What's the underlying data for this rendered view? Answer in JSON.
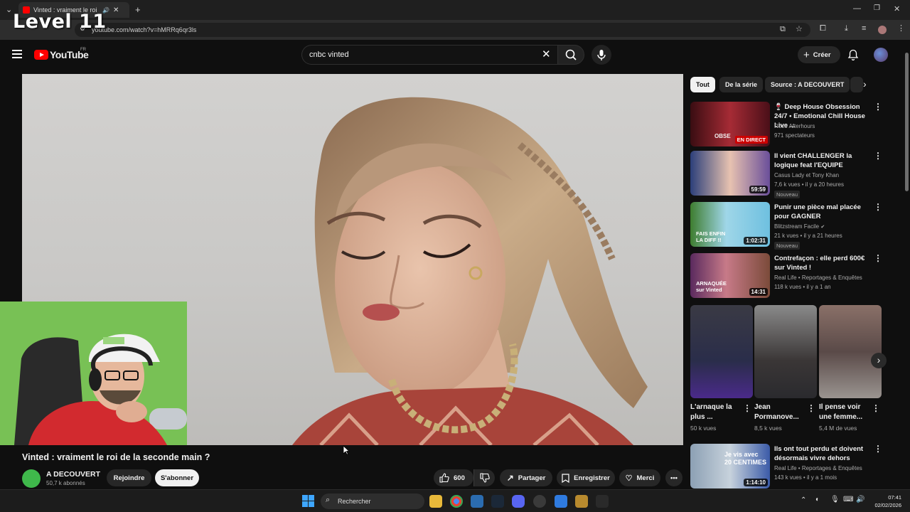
{
  "overlay": {
    "level_text": "Level 11"
  },
  "browser": {
    "tab_title": "Vinted : vraiment le roi de la seconde main ?",
    "url": "youtube.com/watch?v=hMRRq6qr3ls"
  },
  "youtube": {
    "logo_text": "YouTube",
    "region": "FR",
    "search_value": "cnbc vinted",
    "create_label": "Créer"
  },
  "video": {
    "title": "Vinted : vraiment le roi de la seconde main ?",
    "channel_name": "A DECOUVERT",
    "subscribers": "50,7 k abonnés",
    "join_label": "Rejoindre",
    "subscribe_label": "S'abonner",
    "likes": "600",
    "share_label": "Partager",
    "save_label": "Enregistrer",
    "thanks_label": "Merci"
  },
  "chips": [
    "Tout",
    "De la série",
    "Source : A DECOUVERT"
  ],
  "recommendations": [
    {
      "title": "🍷 Deep House Obsession 24/7 • Emotional Chill House Live ...",
      "channel": "Rose Afterhours",
      "meta": "971 spectateurs",
      "badge": "EN DIRECT",
      "thumb_text": "OBSE"
    },
    {
      "title": "Il vient CHALLENGER la logique feat l'EQUIPE",
      "channel": "Casus Lady et Tony Khan",
      "meta": "7,6 k vues • il y a 20 heures",
      "new": "Nouveau",
      "duration": "59:59"
    },
    {
      "title": "Punir une pièce mal placée pour GAGNER",
      "channel": "Blitzstream Facile",
      "meta": "21 k vues • il y a 21 heures",
      "new": "Nouveau",
      "duration": "1:02:31",
      "thumb_text": "FAIS ENFIN LA DIFF !!"
    },
    {
      "title": "Contrefaçon : elle perd 600€ sur Vinted !",
      "channel": "Real Life • Reportages & Enquêtes",
      "meta": "118 k vues • il y a 1 an",
      "duration": "14:31",
      "thumb_text": "ARNAQUÉE sur Vinted"
    },
    {
      "title": "Ils ont tout perdu et doivent désormais vivre dehors",
      "channel": "Real Life • Reportages & Enquêtes",
      "meta": "143 k vues • il y a 1 mois",
      "duration": "1:14:10",
      "thumb_text": "Je vis avec 20 CENTIMES"
    }
  ],
  "shorts": [
    {
      "title": "L'arnaque la plus ...",
      "views": "50 k vues"
    },
    {
      "title": "Jean Pormanove...",
      "views": "8,5 k vues"
    },
    {
      "title": "Il pense voir une femme...",
      "views": "5,4 M de vues"
    }
  ],
  "taskbar": {
    "search_placeholder": "Rechercher",
    "time": "07:41",
    "date": "02/02/2026"
  }
}
